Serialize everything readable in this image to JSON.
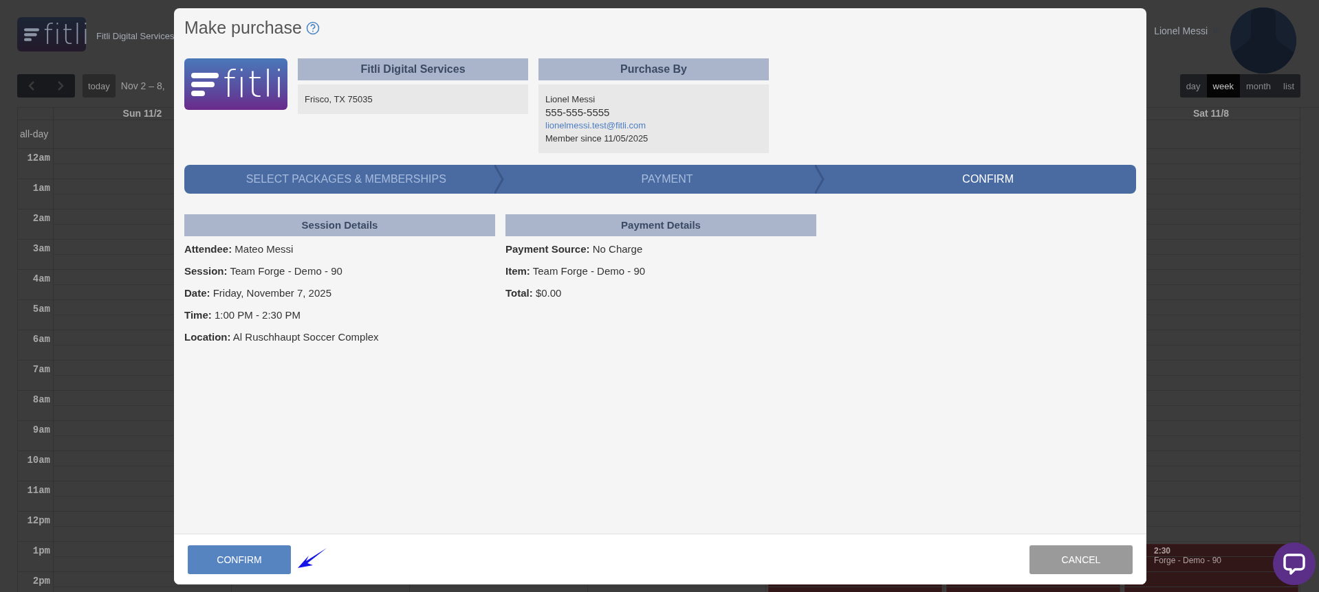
{
  "background": {
    "logo_text": "fitli",
    "brand": "Fitli Digital Services",
    "user_name": "Lionel Messi",
    "toolbar": {
      "today": "today",
      "date_range": "Nov 2 – 8,",
      "views": [
        {
          "label": "day",
          "selected": false
        },
        {
          "label": "week",
          "selected": true
        },
        {
          "label": "month",
          "selected": false
        },
        {
          "label": "list",
          "selected": false
        }
      ]
    },
    "calendar": {
      "first_day": "Sun 11/2",
      "last_day": "Sat 11/8",
      "all_day_label": "all-day",
      "hours": [
        "12am",
        "1am",
        "2am",
        "3am",
        "4am",
        "5am",
        "6am",
        "7am",
        "8am",
        "9am",
        "10am",
        "11am",
        "12pm",
        "1pm",
        "2pm"
      ],
      "events": [
        {
          "kind": "covered"
        },
        {
          "kind": "covered"
        },
        {
          "kind": "labeled",
          "time": "2:30",
          "title": "Forge - Demo - 90"
        }
      ]
    }
  },
  "modal": {
    "title": "Make purchase",
    "logo_text": "fitli",
    "company": {
      "heading": "Fitli Digital Services",
      "address": "Frisco, TX 75035"
    },
    "purchaser": {
      "heading": "Purchase By",
      "name": "Lionel Messi",
      "phone": "555-555-5555",
      "email": "lionelmessi.test@fitli.com",
      "member_since": "Member since 11/05/2025"
    },
    "steps": [
      {
        "label": "SELECT PACKAGES & MEMBERSHIPS",
        "selected": false
      },
      {
        "label": "PAYMENT",
        "selected": false
      },
      {
        "label": "CONFIRM",
        "selected": true
      }
    ],
    "sections": [
      {
        "heading": "Session Details",
        "fields": [
          {
            "label": "Attendee:",
            "value": "Mateo Messi"
          },
          {
            "label": "Session:",
            "value": "Team Forge - Demo - 90"
          },
          {
            "label": "Date:",
            "value": "Friday, November 7, 2025"
          },
          {
            "label": "Time:",
            "value": "1:00 PM - 2:30 PM"
          },
          {
            "label": "Location:",
            "value": "Al Ruschhaupt Soccer Complex"
          }
        ]
      },
      {
        "heading": "Payment Details",
        "fields": [
          {
            "label": "Payment Source:",
            "value": "No Charge"
          },
          {
            "label": "Item:",
            "value": "Team Forge - Demo - 90"
          },
          {
            "label": "Total:",
            "value": "$0.00"
          }
        ]
      }
    ],
    "confirm_button": "CONFIRM",
    "cancel_button": "CANCEL"
  }
}
